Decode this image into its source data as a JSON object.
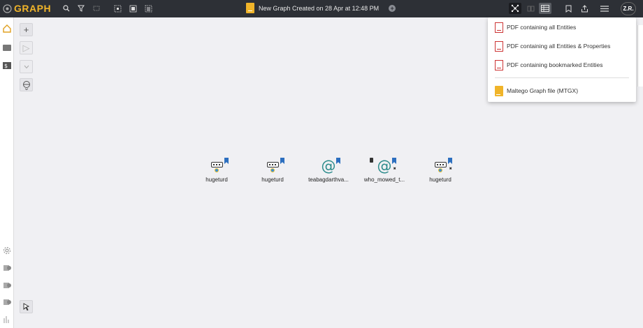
{
  "app": {
    "logo_text": "GRAPH"
  },
  "header": {
    "title": "New Graph Created on 28 Apr at 12:48 PM",
    "avatar_initials": "Z.R."
  },
  "colors": {
    "accent": "#f0b429",
    "topbar": "#2d3036",
    "bookmark": "#2c6fbf",
    "canvas": "#f0f0f3"
  },
  "toolbar_icons": [
    "search-icon",
    "filter-icon",
    "grid-icon",
    "select-all-icon",
    "select-frame-icon",
    "list-select-icon"
  ],
  "tools": {
    "add": "+",
    "play": "▷"
  },
  "entities": [
    {
      "label": "hugeturd",
      "type": "router",
      "bookmarked": true,
      "pinned": false
    },
    {
      "label": "hugeturd",
      "type": "router",
      "bookmarked": true,
      "pinned": false
    },
    {
      "label": "teabagdarthva...",
      "type": "email",
      "bookmarked": true,
      "pinned": false
    },
    {
      "label": "who_mowed_t...",
      "type": "email",
      "bookmarked": true,
      "pinned": true
    },
    {
      "label": "hugeturd",
      "type": "router",
      "bookmarked": true,
      "pinned": true
    }
  ],
  "export_menu": {
    "items": [
      {
        "label": "PDF containing all Entities"
      },
      {
        "label": "PDF containing all Entities & Properties"
      },
      {
        "label": "PDF containing bookmarked Entities"
      },
      {
        "label": "Maltego Graph file (MTGX)"
      }
    ]
  }
}
